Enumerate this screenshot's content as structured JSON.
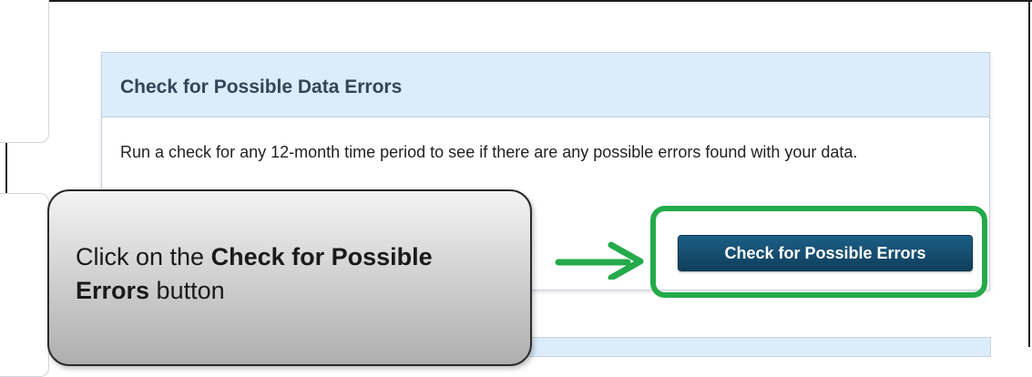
{
  "panel": {
    "title": "Check for Possible Data Errors",
    "description": "Run a check for any 12-month time period to see if there are any possible errors found with your data.",
    "button_label": "Check for Possible Errors"
  },
  "callout": {
    "prefix": "Click on the ",
    "bold": "Check for Possible Errors",
    "suffix": " button"
  },
  "colors": {
    "header_bg": "#dcecfb",
    "button_bg": "#1d5f86",
    "highlight": "#24aa4a",
    "arrow": "#24aa4a"
  }
}
